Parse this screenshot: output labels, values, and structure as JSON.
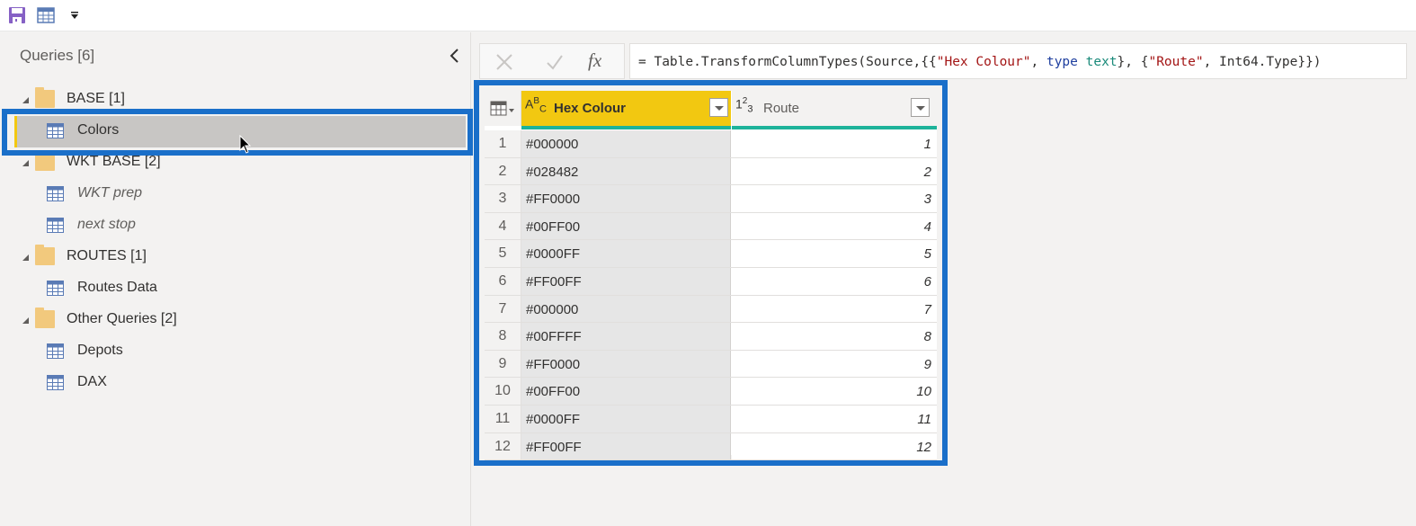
{
  "quick_access": {
    "icons": [
      "save-icon",
      "table-icon",
      "customize-dropdown-icon"
    ]
  },
  "queries_pane": {
    "title": "Queries [6]",
    "collapse_icon": "chevron-left-icon",
    "tree": [
      {
        "type": "folder",
        "label": "BASE [1]"
      },
      {
        "type": "query",
        "label": "Colors",
        "selected": true
      },
      {
        "type": "folder",
        "label": "WKT BASE [2]"
      },
      {
        "type": "query",
        "label": "WKT prep",
        "italic": true
      },
      {
        "type": "query",
        "label": "next stop",
        "italic": true
      },
      {
        "type": "folder",
        "label": "ROUTES [1]"
      },
      {
        "type": "query",
        "label": "Routes Data"
      },
      {
        "type": "folder",
        "label": "Other Queries [2]"
      },
      {
        "type": "query",
        "label": "Depots"
      },
      {
        "type": "query",
        "label": "DAX"
      }
    ]
  },
  "formula_bar": {
    "cancel_icon": "close-icon",
    "commit_icon": "check-icon",
    "fx_label": "fx",
    "formula_parts": {
      "p1": "= Table.TransformColumnTypes(Source,{{",
      "s1": "\"Hex Colour\"",
      "p2": ", ",
      "k1": "type",
      "p3": " ",
      "t1": "text",
      "p4": "}, {",
      "s2": "\"Route\"",
      "p5": ", Int64.Type}})"
    }
  },
  "grid": {
    "columns": [
      {
        "name": "Hex Colour",
        "type_icon": "ABC",
        "selected": true
      },
      {
        "name": "Route",
        "type_icon": "123"
      }
    ],
    "rows": [
      {
        "idx": "1",
        "hex": "#000000",
        "route": "1"
      },
      {
        "idx": "2",
        "hex": "#028482",
        "route": "2"
      },
      {
        "idx": "3",
        "hex": "#FF0000",
        "route": "3"
      },
      {
        "idx": "4",
        "hex": "#00FF00",
        "route": "4"
      },
      {
        "idx": "5",
        "hex": "#0000FF",
        "route": "5"
      },
      {
        "idx": "6",
        "hex": "#FF00FF",
        "route": "6"
      },
      {
        "idx": "7",
        "hex": "#000000",
        "route": "7"
      },
      {
        "idx": "8",
        "hex": "#00FFFF",
        "route": "8"
      },
      {
        "idx": "9",
        "hex": "#FF0000",
        "route": "9"
      },
      {
        "idx": "10",
        "hex": "#00FF00",
        "route": "10"
      },
      {
        "idx": "11",
        "hex": "#0000FF",
        "route": "11"
      },
      {
        "idx": "12",
        "hex": "#FF00FF",
        "route": "12"
      }
    ]
  },
  "colors": {
    "highlight_border": "#1a6fc9",
    "selected_column": "#f2c811",
    "quality_bar": "#1db39a",
    "folder": "#f2c97d"
  }
}
